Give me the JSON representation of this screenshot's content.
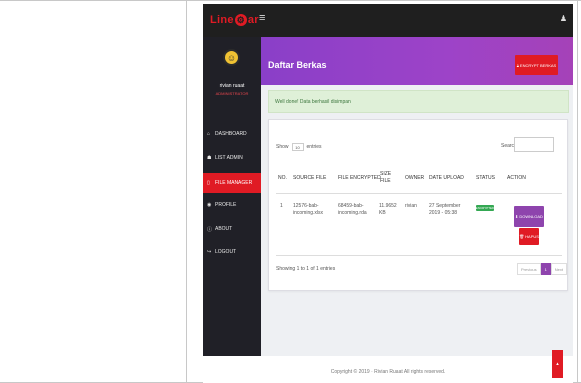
{
  "app": {
    "logo_left": "Line",
    "logo_right": "ar",
    "menu_icon": "hamburger-icon",
    "user_icon": "user-icon"
  },
  "user": {
    "name": "rivian ruaat",
    "role": "ADMINISTRATOR"
  },
  "nav": [
    {
      "label": "DASHBOARD",
      "icon": "home-icon",
      "glyph": "⌂",
      "active": false
    },
    {
      "label": "LIST ADMIN",
      "icon": "users-icon",
      "glyph": "☗",
      "active": false
    },
    {
      "label": "FILE MANAGER",
      "icon": "file-icon",
      "glyph": "▯",
      "active": true
    },
    {
      "label": "PROFILE",
      "icon": "profile-icon",
      "glyph": "◉",
      "active": false
    },
    {
      "label": "ABOUT",
      "icon": "info-icon",
      "glyph": "ⓘ",
      "active": false
    },
    {
      "label": "LOGOUT",
      "icon": "logout-icon",
      "glyph": "↪",
      "active": false
    }
  ],
  "page": {
    "title": "Daftar Berkas",
    "encrypt_button": "ENCRYPT BERKAS",
    "alert": "Well done! Data berhasil disimpan"
  },
  "table": {
    "show_label": "Show",
    "show_value": "10",
    "entries_label": "entries",
    "search_label": "Search:",
    "columns": [
      "NO.",
      "SOURCE FILE",
      "FILE ENCRYPTED",
      "SIZE FILE",
      "OWNER",
      "DATE UPLOAD",
      "STATUS",
      "ACTION"
    ],
    "rows": [
      {
        "no": "1",
        "source_file": "12576-bab-incoming.xlsx",
        "file_encrypted": "68459-bab-incoming.rda",
        "size": "11.9652 KB",
        "owner": "rivian",
        "date": "27 September 2019 - 05:38",
        "status": "ENCRYPTED",
        "download": "DOWNLOAD",
        "delete": "HAPUS"
      }
    ],
    "info": "Showing 1 to 1 of 1 entries",
    "prev": "Previous",
    "page": "1",
    "next": "Next"
  },
  "footer": {
    "text": "Copyright © 2019 · Rivian Ruaat All rights reserved."
  },
  "colors": {
    "accent_red": "#e01b24",
    "header_purple": "#8a3fc8",
    "sidebar": "#202027",
    "topbar": "#1f1f1f"
  }
}
